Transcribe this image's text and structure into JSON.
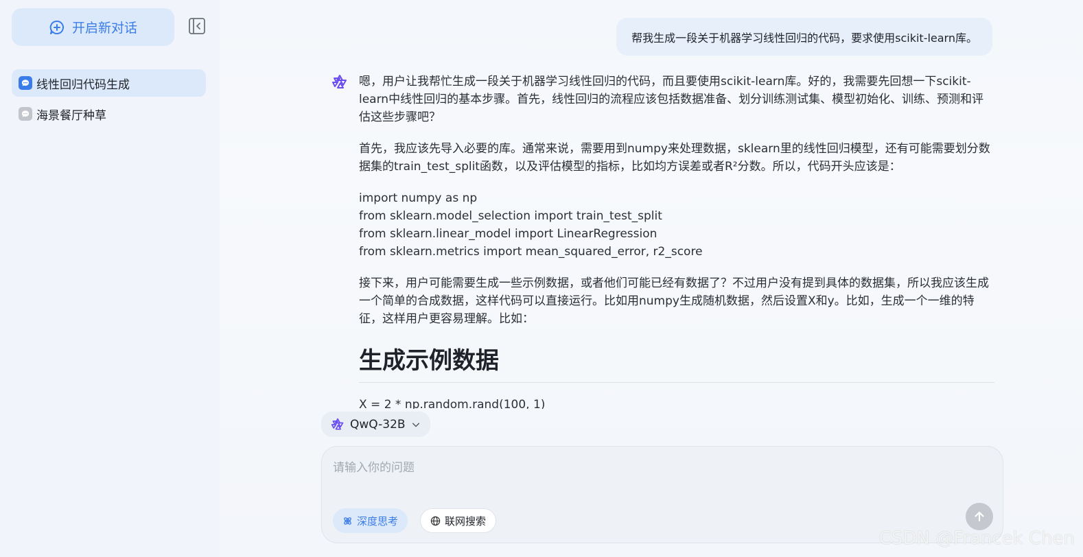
{
  "sidebar": {
    "new_chat_label": "开启新对话",
    "conversations": [
      {
        "label": "线性回归代码生成",
        "active": true
      },
      {
        "label": "海景餐厅种草",
        "active": false
      }
    ]
  },
  "chat": {
    "user_message": "帮我生成一段关于机器学习线性回归的代码，要求使用scikit-learn库。",
    "assistant": {
      "paragraphs": [
        "嗯，用户让我帮忙生成一段关于机器学习线性回归的代码，而且要使用scikit-learn库。好的，我需要先回想一下scikit-learn中线性回归的基本步骤。首先，线性回归的流程应该包括数据准备、划分训练测试集、模型初始化、训练、预测和评估这些步骤吧？",
        "首先，我应该先导入必要的库。通常来说，需要用到numpy来处理数据，sklearn里的线性回归模型，还有可能需要划分数据集的train_test_split函数，以及评估模型的指标，比如均方误差或者R²分数。所以，代码开头应该是："
      ],
      "code_lines": [
        "import numpy as np",
        "from sklearn.model_selection import train_test_split",
        "from sklearn.linear_model import LinearRegression",
        "from sklearn.metrics import mean_squared_error, r2_score"
      ],
      "paragraph_after_code": "接下来，用户可能需要生成一些示例数据，或者他们可能已经有数据了？不过用户没有提到具体的数据集，所以我应该生成一个简单的合成数据，这样代码可以直接运行。比如用numpy生成随机数据，然后设置X和y。比如，生成一个一维的特征，这样用户更容易理解。比如：",
      "heading": "生成示例数据",
      "trailing_text": "X = 2 * np.random.rand(100, 1)"
    }
  },
  "composer": {
    "model_name": "QwQ-32B",
    "placeholder": "请输入你的问题",
    "deep_think_label": "深度思考",
    "web_search_label": "联网搜索"
  },
  "watermark": "CSDN @Francek Chen",
  "colors": {
    "accent": "#3b7de8",
    "accent_light": "#dce9fb",
    "send_disabled": "#c5c9cf"
  }
}
